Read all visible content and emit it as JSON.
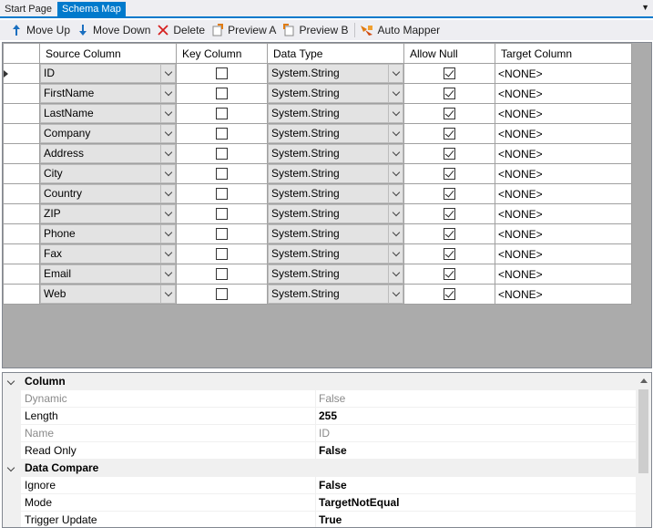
{
  "tabs": [
    {
      "label": "Start Page",
      "active": false
    },
    {
      "label": "Schema Map",
      "active": true
    }
  ],
  "toolbar": {
    "move_up": "Move Up",
    "move_down": "Move Down",
    "delete": "Delete",
    "preview_a": "Preview A",
    "preview_b": "Preview B",
    "auto_mapper": "Auto Mapper"
  },
  "grid": {
    "headers": {
      "source": "Source Column",
      "key": "Key Column",
      "type": "Data Type",
      "null": "Allow Null",
      "target": "Target Column"
    },
    "rows": [
      {
        "source": "ID",
        "key": false,
        "type": "System.String",
        "allow_null": true,
        "target": "<NONE>"
      },
      {
        "source": "FirstName",
        "key": false,
        "type": "System.String",
        "allow_null": true,
        "target": "<NONE>"
      },
      {
        "source": "LastName",
        "key": false,
        "type": "System.String",
        "allow_null": true,
        "target": "<NONE>"
      },
      {
        "source": "Company",
        "key": false,
        "type": "System.String",
        "allow_null": true,
        "target": "<NONE>"
      },
      {
        "source": "Address",
        "key": false,
        "type": "System.String",
        "allow_null": true,
        "target": "<NONE>"
      },
      {
        "source": "City",
        "key": false,
        "type": "System.String",
        "allow_null": true,
        "target": "<NONE>"
      },
      {
        "source": "Country",
        "key": false,
        "type": "System.String",
        "allow_null": true,
        "target": "<NONE>"
      },
      {
        "source": "ZIP",
        "key": false,
        "type": "System.String",
        "allow_null": true,
        "target": "<NONE>"
      },
      {
        "source": "Phone",
        "key": false,
        "type": "System.String",
        "allow_null": true,
        "target": "<NONE>"
      },
      {
        "source": "Fax",
        "key": false,
        "type": "System.String",
        "allow_null": true,
        "target": "<NONE>"
      },
      {
        "source": "Email",
        "key": false,
        "type": "System.String",
        "allow_null": true,
        "target": "<NONE>"
      },
      {
        "source": "Web",
        "key": false,
        "type": "System.String",
        "allow_null": true,
        "target": "<NONE>"
      }
    ]
  },
  "properties": {
    "categories": [
      {
        "name": "Column",
        "rows": [
          {
            "name": "Dynamic",
            "value": "False",
            "readonly": true
          },
          {
            "name": "Length",
            "value": "255",
            "readonly": false
          },
          {
            "name": "Name",
            "value": "ID",
            "readonly": true
          },
          {
            "name": "Read Only",
            "value": "False",
            "readonly": false
          }
        ]
      },
      {
        "name": "Data Compare",
        "rows": [
          {
            "name": "Ignore",
            "value": "False",
            "readonly": false
          },
          {
            "name": "Mode",
            "value": "TargetNotEqual",
            "readonly": false
          },
          {
            "name": "Trigger Update",
            "value": "True",
            "readonly": false
          }
        ]
      }
    ]
  },
  "colors": {
    "accent": "#007acc",
    "chrome": "#eeeef2",
    "grid_background": "#ababab"
  },
  "icons": {
    "move_up": "arrow-up-icon",
    "move_down": "arrow-down-icon",
    "delete": "red-x-icon",
    "preview_a": "preview-a-icon",
    "preview_b": "preview-b-icon",
    "auto_mapper": "auto-mapper-icon"
  }
}
